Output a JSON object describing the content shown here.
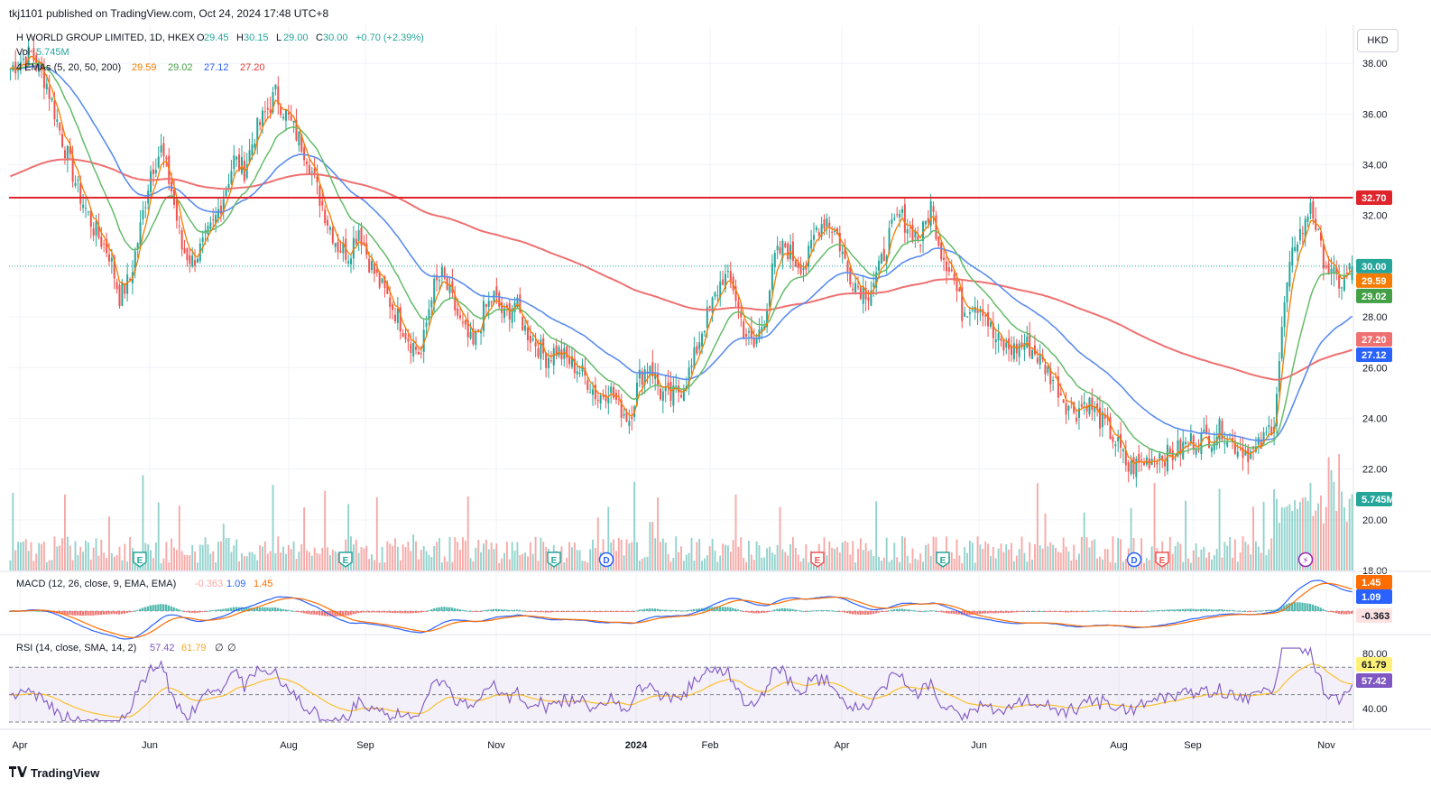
{
  "header": {
    "published": "tkj1101 published on TradingView.com, Oct 24, 2024 17:48 UTC+8",
    "symbol": "H WORLD GROUP LIMITED, 1D, HKEX",
    "ohlc": {
      "o_label": "O",
      "o": "29.45",
      "h_label": "H",
      "h": "30.15",
      "l_label": "L",
      "l": "29.00",
      "c_label": "C",
      "c": "30.00",
      "change": "+0.70 (+2.39%)"
    },
    "vol_label": "Vol",
    "vol_value": "5.745M",
    "ema_label": "4 EMAs (5, 20, 50, 200)",
    "ema_values": [
      "29.59",
      "29.02",
      "27.12",
      "27.20"
    ]
  },
  "currency": "HKD",
  "footer": {
    "brand": "TradingView"
  },
  "colors": {
    "up": "#26a69a",
    "down": "#ef5350",
    "ema5": "#f57c00",
    "ema20": "#66bb6a",
    "ema50": "#5b8def",
    "ema200": "#ef7070",
    "resistance": "#e0242c",
    "macd": "#2962ff",
    "signal": "#ff6d00",
    "rsi": "#7e57c2",
    "rsi_ma": "#fbc02d"
  },
  "chart_data": [
    {
      "type": "candlestick",
      "title": "H WORLD GROUP LIMITED, 1D, HKEX",
      "x_ticks": [
        "Apr",
        "Jun",
        "Aug",
        "Sep",
        "Nov",
        "2024",
        "Feb",
        "Apr",
        "Jun",
        "Aug",
        "Sep",
        "Nov"
      ],
      "y_ticks": [
        "38.00",
        "36.00",
        "34.00",
        "32.00",
        "28.00",
        "26.00",
        "24.00",
        "22.00",
        "20.00",
        "18.00"
      ],
      "ylim": [
        18,
        39.5
      ],
      "resistance_level": 32.7,
      "resistance_label": "32.70",
      "close_label": "30.00",
      "ema_labels": {
        "ema5": "29.59",
        "ema20": "29.02",
        "ema50": "27.12",
        "ema200": "27.20"
      },
      "volume_label": "5.745M",
      "anchor_series": {
        "description_free": true,
        "close_anchors": [
          [
            0,
            37.8
          ],
          [
            8,
            38.4
          ],
          [
            14,
            37.2
          ],
          [
            20,
            35.0
          ],
          [
            26,
            33.0
          ],
          [
            32,
            31.5
          ],
          [
            38,
            30.5
          ],
          [
            42,
            28.8
          ],
          [
            46,
            29.5
          ],
          [
            50,
            31.5
          ],
          [
            54,
            33.8
          ],
          [
            58,
            34.6
          ],
          [
            62,
            33.0
          ],
          [
            66,
            30.7
          ],
          [
            70,
            30.2
          ],
          [
            74,
            30.8
          ],
          [
            78,
            31.6
          ],
          [
            82,
            32.8
          ],
          [
            86,
            34.2
          ],
          [
            90,
            33.8
          ],
          [
            94,
            35.2
          ],
          [
            98,
            36.0
          ],
          [
            102,
            36.8
          ],
          [
            106,
            36.0
          ],
          [
            110,
            35.2
          ],
          [
            114,
            34.4
          ],
          [
            118,
            33.0
          ],
          [
            122,
            31.8
          ],
          [
            126,
            30.8
          ],
          [
            130,
            30.5
          ],
          [
            134,
            31.5
          ],
          [
            138,
            30.2
          ],
          [
            142,
            29.3
          ],
          [
            146,
            28.6
          ],
          [
            150,
            27.8
          ],
          [
            154,
            27.0
          ],
          [
            158,
            26.5
          ],
          [
            162,
            29.0
          ],
          [
            166,
            29.6
          ],
          [
            170,
            28.6
          ],
          [
            174,
            27.5
          ],
          [
            178,
            26.8
          ],
          [
            182,
            28.2
          ],
          [
            186,
            28.8
          ],
          [
            190,
            28.0
          ],
          [
            194,
            28.6
          ],
          [
            198,
            27.5
          ],
          [
            202,
            27.0
          ],
          [
            206,
            26.4
          ],
          [
            210,
            26.7
          ],
          [
            214,
            26.3
          ],
          [
            218,
            26.0
          ],
          [
            222,
            25.5
          ],
          [
            226,
            24.8
          ],
          [
            230,
            25.2
          ],
          [
            234,
            24.5
          ],
          [
            238,
            24.0
          ],
          [
            242,
            25.6
          ],
          [
            246,
            26.2
          ],
          [
            250,
            25.0
          ],
          [
            254,
            24.8
          ],
          [
            258,
            25.2
          ],
          [
            262,
            26.0
          ],
          [
            266,
            27.5
          ],
          [
            270,
            28.5
          ],
          [
            274,
            29.6
          ],
          [
            278,
            29.2
          ],
          [
            282,
            27.5
          ],
          [
            286,
            26.8
          ],
          [
            290,
            28.0
          ],
          [
            294,
            30.3
          ],
          [
            298,
            30.8
          ],
          [
            302,
            30.2
          ],
          [
            306,
            30.0
          ],
          [
            310,
            31.5
          ],
          [
            314,
            31.9
          ],
          [
            318,
            31.2
          ],
          [
            322,
            29.8
          ],
          [
            326,
            29.2
          ],
          [
            330,
            29.0
          ],
          [
            334,
            29.8
          ],
          [
            338,
            31.2
          ],
          [
            342,
            32.0
          ],
          [
            346,
            31.5
          ],
          [
            350,
            31.0
          ],
          [
            354,
            32.4
          ],
          [
            358,
            30.6
          ],
          [
            362,
            29.8
          ],
          [
            366,
            28.2
          ],
          [
            370,
            28.6
          ],
          [
            374,
            28.4
          ],
          [
            378,
            27.2
          ],
          [
            382,
            26.8
          ],
          [
            386,
            26.7
          ],
          [
            390,
            27.0
          ],
          [
            394,
            26.6
          ],
          [
            398,
            26.0
          ],
          [
            402,
            25.4
          ],
          [
            406,
            24.6
          ],
          [
            410,
            24.3
          ],
          [
            414,
            24.7
          ],
          [
            418,
            24.1
          ],
          [
            422,
            23.6
          ],
          [
            426,
            22.9
          ],
          [
            430,
            22.0
          ],
          [
            434,
            22.2
          ],
          [
            438,
            22.4
          ],
          [
            442,
            22.6
          ],
          [
            446,
            22.5
          ],
          [
            450,
            22.8
          ],
          [
            454,
            23.1
          ],
          [
            458,
            23.2
          ],
          [
            462,
            23.3
          ],
          [
            466,
            23.6
          ],
          [
            470,
            23.0
          ],
          [
            474,
            22.8
          ],
          [
            478,
            22.6
          ],
          [
            482,
            23.1
          ],
          [
            486,
            24.0
          ],
          [
            490,
            28.5
          ],
          [
            494,
            31.0
          ],
          [
            498,
            31.6
          ],
          [
            500,
            32.6
          ],
          [
            504,
            30.6
          ],
          [
            508,
            29.6
          ],
          [
            512,
            29.3
          ],
          [
            516,
            30.0
          ]
        ]
      }
    },
    {
      "type": "line",
      "title": "MACD (12, 26, close, 9, EMA, EMA)",
      "series": [
        {
          "name": "MACD",
          "label_value": "1.09"
        },
        {
          "name": "Signal",
          "label_value": "1.45"
        },
        {
          "name": "Histogram",
          "label_value": "-0.363"
        }
      ]
    },
    {
      "type": "line",
      "title": "RSI (14, close, SMA, 14, 2)",
      "ylim": [
        30,
        88
      ],
      "y_ticks": [
        "80.00",
        "40.00"
      ],
      "bands": {
        "upper": 70,
        "middle": 50,
        "lower": 30
      },
      "series": [
        {
          "name": "RSI",
          "label_value": "57.42"
        },
        {
          "name": "RSI-based MA",
          "label_value": "61.79"
        }
      ]
    }
  ],
  "legend_rsi": {
    "title": "RSI (14, close, SMA, 14, 2)",
    "v1": "57.42",
    "v2": "61.79",
    "v3": "∅",
    "v4": "∅"
  },
  "legend_macd": {
    "title": "MACD (12, 26, close, 9, EMA, EMA)",
    "v1": "-0.363",
    "v2": "1.09",
    "v3": "1.45"
  },
  "event_markers": [
    {
      "letter": "E",
      "kind": "earnings-up"
    },
    {
      "letter": "E",
      "kind": "earnings-up"
    },
    {
      "letter": "E",
      "kind": "earnings-up"
    },
    {
      "letter": "D",
      "kind": "dividend"
    },
    {
      "letter": "E",
      "kind": "earnings-down"
    },
    {
      "letter": "E",
      "kind": "earnings-up"
    },
    {
      "letter": "D",
      "kind": "dividend"
    },
    {
      "letter": "E",
      "kind": "earnings-down"
    },
    {
      "letter": "⚡",
      "kind": "upcoming"
    }
  ]
}
